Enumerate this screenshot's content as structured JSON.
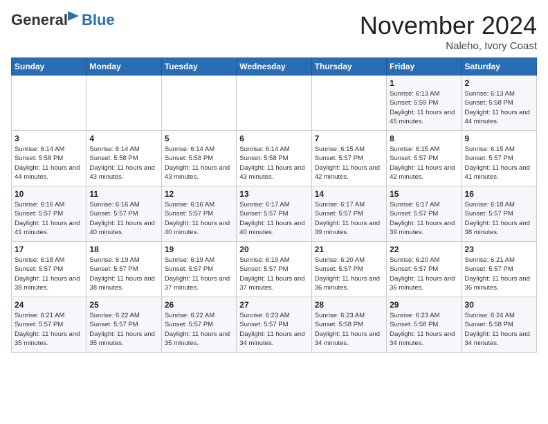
{
  "logo": {
    "general": "General",
    "blue": "Blue"
  },
  "header": {
    "month": "November 2024",
    "location": "Naleho, Ivory Coast"
  },
  "weekdays": [
    "Sunday",
    "Monday",
    "Tuesday",
    "Wednesday",
    "Thursday",
    "Friday",
    "Saturday"
  ],
  "weeks": [
    [
      {
        "day": "",
        "info": ""
      },
      {
        "day": "",
        "info": ""
      },
      {
        "day": "",
        "info": ""
      },
      {
        "day": "",
        "info": ""
      },
      {
        "day": "",
        "info": ""
      },
      {
        "day": "1",
        "info": "Sunrise: 6:13 AM\nSunset: 5:59 PM\nDaylight: 11 hours and 45 minutes."
      },
      {
        "day": "2",
        "info": "Sunrise: 6:13 AM\nSunset: 5:58 PM\nDaylight: 11 hours and 44 minutes."
      }
    ],
    [
      {
        "day": "3",
        "info": "Sunrise: 6:14 AM\nSunset: 5:58 PM\nDaylight: 11 hours and 44 minutes."
      },
      {
        "day": "4",
        "info": "Sunrise: 6:14 AM\nSunset: 5:58 PM\nDaylight: 11 hours and 43 minutes."
      },
      {
        "day": "5",
        "info": "Sunrise: 6:14 AM\nSunset: 5:58 PM\nDaylight: 11 hours and 43 minutes."
      },
      {
        "day": "6",
        "info": "Sunrise: 6:14 AM\nSunset: 5:58 PM\nDaylight: 11 hours and 43 minutes."
      },
      {
        "day": "7",
        "info": "Sunrise: 6:15 AM\nSunset: 5:57 PM\nDaylight: 11 hours and 42 minutes."
      },
      {
        "day": "8",
        "info": "Sunrise: 6:15 AM\nSunset: 5:57 PM\nDaylight: 11 hours and 42 minutes."
      },
      {
        "day": "9",
        "info": "Sunrise: 6:15 AM\nSunset: 5:57 PM\nDaylight: 11 hours and 41 minutes."
      }
    ],
    [
      {
        "day": "10",
        "info": "Sunrise: 6:16 AM\nSunset: 5:57 PM\nDaylight: 11 hours and 41 minutes."
      },
      {
        "day": "11",
        "info": "Sunrise: 6:16 AM\nSunset: 5:57 PM\nDaylight: 11 hours and 40 minutes."
      },
      {
        "day": "12",
        "info": "Sunrise: 6:16 AM\nSunset: 5:57 PM\nDaylight: 11 hours and 40 minutes."
      },
      {
        "day": "13",
        "info": "Sunrise: 6:17 AM\nSunset: 5:57 PM\nDaylight: 11 hours and 40 minutes."
      },
      {
        "day": "14",
        "info": "Sunrise: 6:17 AM\nSunset: 5:57 PM\nDaylight: 11 hours and 39 minutes."
      },
      {
        "day": "15",
        "info": "Sunrise: 6:17 AM\nSunset: 5:57 PM\nDaylight: 11 hours and 39 minutes."
      },
      {
        "day": "16",
        "info": "Sunrise: 6:18 AM\nSunset: 5:57 PM\nDaylight: 11 hours and 38 minutes."
      }
    ],
    [
      {
        "day": "17",
        "info": "Sunrise: 6:18 AM\nSunset: 5:57 PM\nDaylight: 11 hours and 38 minutes."
      },
      {
        "day": "18",
        "info": "Sunrise: 6:19 AM\nSunset: 5:57 PM\nDaylight: 11 hours and 38 minutes."
      },
      {
        "day": "19",
        "info": "Sunrise: 6:19 AM\nSunset: 5:57 PM\nDaylight: 11 hours and 37 minutes."
      },
      {
        "day": "20",
        "info": "Sunrise: 6:19 AM\nSunset: 5:57 PM\nDaylight: 11 hours and 37 minutes."
      },
      {
        "day": "21",
        "info": "Sunrise: 6:20 AM\nSunset: 5:57 PM\nDaylight: 11 hours and 36 minutes."
      },
      {
        "day": "22",
        "info": "Sunrise: 6:20 AM\nSunset: 5:57 PM\nDaylight: 11 hours and 36 minutes."
      },
      {
        "day": "23",
        "info": "Sunrise: 6:21 AM\nSunset: 5:57 PM\nDaylight: 11 hours and 36 minutes."
      }
    ],
    [
      {
        "day": "24",
        "info": "Sunrise: 6:21 AM\nSunset: 5:57 PM\nDaylight: 11 hours and 35 minutes."
      },
      {
        "day": "25",
        "info": "Sunrise: 6:22 AM\nSunset: 5:57 PM\nDaylight: 11 hours and 35 minutes."
      },
      {
        "day": "26",
        "info": "Sunrise: 6:22 AM\nSunset: 5:57 PM\nDaylight: 11 hours and 35 minutes."
      },
      {
        "day": "27",
        "info": "Sunrise: 6:23 AM\nSunset: 5:57 PM\nDaylight: 11 hours and 34 minutes."
      },
      {
        "day": "28",
        "info": "Sunrise: 6:23 AM\nSunset: 5:58 PM\nDaylight: 11 hours and 34 minutes."
      },
      {
        "day": "29",
        "info": "Sunrise: 6:23 AM\nSunset: 5:58 PM\nDaylight: 11 hours and 34 minutes."
      },
      {
        "day": "30",
        "info": "Sunrise: 6:24 AM\nSunset: 5:58 PM\nDaylight: 11 hours and 34 minutes."
      }
    ]
  ]
}
